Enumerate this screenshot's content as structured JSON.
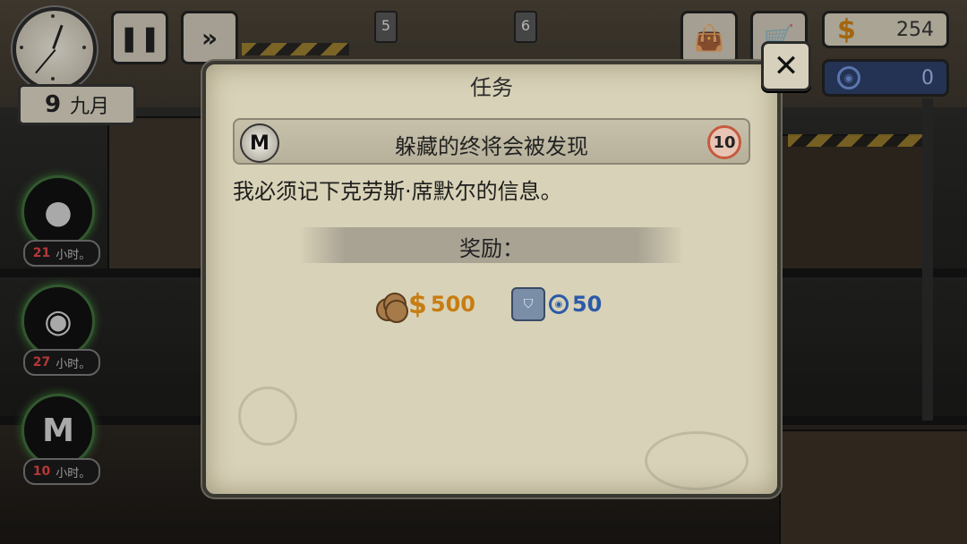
{
  "hud": {
    "day": "9",
    "month": "九月",
    "floor_left": "5",
    "floor_right": "6",
    "money": "254",
    "tokens": "0",
    "dollar_symbol": "$"
  },
  "characters": [
    {
      "hours": "21",
      "unit": "小时。"
    },
    {
      "hours": "27",
      "unit": "小时。"
    },
    {
      "hours": "10",
      "unit": "小时。"
    }
  ],
  "dialog": {
    "title": "任务",
    "quest_name": "躲藏的终将会被发现",
    "quest_badge": "M",
    "quest_level": "10",
    "description": "我必须记下克劳斯·席默尔的信息。",
    "reward_label": "奖励：",
    "reward_money": "500",
    "reward_tokens": "50",
    "close_symbol": "✕"
  },
  "colors": {
    "money": "#c77d12",
    "token": "#2c5aa8",
    "panel": "#d8d2b8"
  }
}
